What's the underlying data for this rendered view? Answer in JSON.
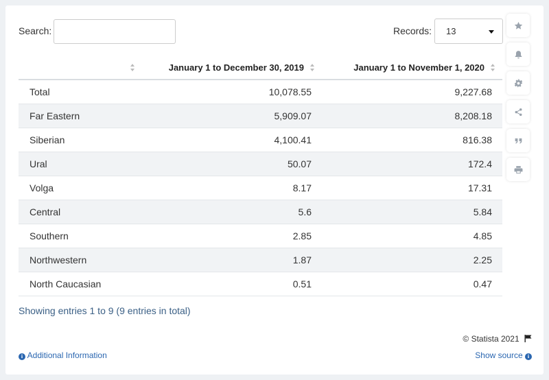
{
  "search": {
    "label": "Search:",
    "value": ""
  },
  "records": {
    "label": "Records:",
    "selected": "13"
  },
  "table": {
    "headers": [
      "",
      "January 1 to December 30, 2019",
      "January 1 to November 1, 2020"
    ],
    "rows": [
      {
        "region": "Total",
        "v2019": "10,078.55",
        "v2020": "9,227.68"
      },
      {
        "region": "Far Eastern",
        "v2019": "5,909.07",
        "v2020": "8,208.18"
      },
      {
        "region": "Siberian",
        "v2019": "4,100.41",
        "v2020": "816.38"
      },
      {
        "region": "Ural",
        "v2019": "50.07",
        "v2020": "172.4"
      },
      {
        "region": "Volga",
        "v2019": "8.17",
        "v2020": "17.31"
      },
      {
        "region": "Central",
        "v2019": "5.6",
        "v2020": "5.84"
      },
      {
        "region": "Southern",
        "v2019": "2.85",
        "v2020": "4.85"
      },
      {
        "region": "Northwestern",
        "v2019": "1.87",
        "v2020": "2.25"
      },
      {
        "region": "North Caucasian",
        "v2019": "0.51",
        "v2020": "0.47"
      }
    ]
  },
  "footer": {
    "entries_text": "Showing entries 1 to 9 (9 entries in total)",
    "credit": "© Statista 2021",
    "additional_info": "Additional Information",
    "show_source": "Show source"
  },
  "sidebar_icons": [
    "star-icon",
    "bell-icon",
    "gear-icon",
    "share-icon",
    "quote-icon",
    "print-icon"
  ],
  "colors": {
    "accent": "#2a66b0",
    "footer_text": "#3a5f85",
    "stripe": "#f1f3f5"
  }
}
